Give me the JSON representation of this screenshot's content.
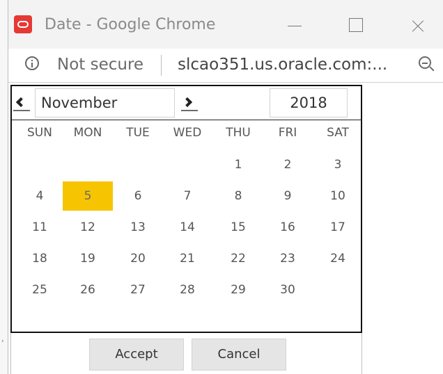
{
  "window": {
    "title": "Date - Google Chrome"
  },
  "addressbar": {
    "security_label": "Not secure",
    "url_text": "slcao351.us.oracle.com:..."
  },
  "calendar": {
    "month": "November",
    "year": "2018",
    "selected_day": "5",
    "weekdays": [
      "SUN",
      "MON",
      "TUE",
      "WED",
      "THU",
      "FRI",
      "SAT"
    ],
    "weeks": [
      [
        "",
        "",
        "",
        "",
        "1",
        "2",
        "3"
      ],
      [
        "4",
        "5",
        "6",
        "7",
        "8",
        "9",
        "10"
      ],
      [
        "11",
        "12",
        "13",
        "14",
        "15",
        "16",
        "17"
      ],
      [
        "18",
        "19",
        "20",
        "21",
        "22",
        "23",
        "24"
      ],
      [
        "25",
        "26",
        "27",
        "28",
        "29",
        "30",
        ""
      ]
    ]
  },
  "footer": {
    "accept_label": "Accept",
    "cancel_label": "Cancel"
  },
  "colors": {
    "selected_day_bg": "#f6c400",
    "brand_icon": "#e53935"
  },
  "icons": {
    "app": "oracle-app-icon",
    "info": "info-icon",
    "zoom": "zoom-icon",
    "prev": "chevron-left-icon",
    "next": "chevron-right-icon"
  }
}
